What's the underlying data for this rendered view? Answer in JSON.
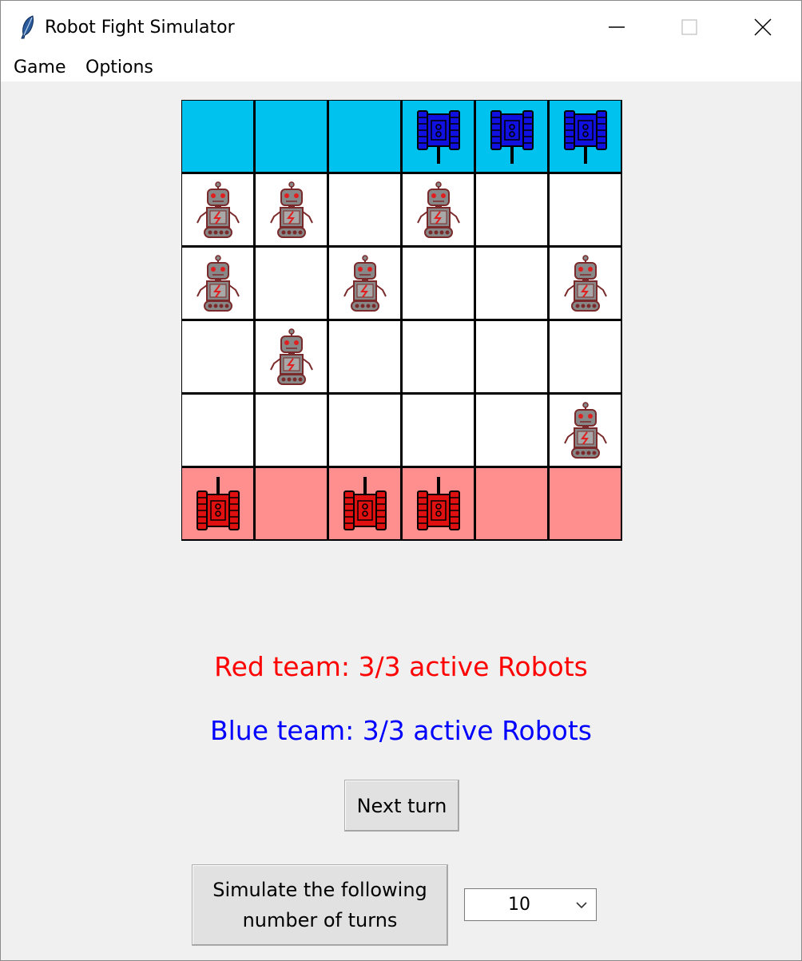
{
  "window": {
    "title": "Robot Fight Simulator"
  },
  "menu": {
    "items": [
      "Game",
      "Options"
    ]
  },
  "board": {
    "colors": {
      "blue_zone": "#00c2ee",
      "red_zone": "#ff8e8e",
      "empty": "#ffffff",
      "blue_tank": "#1010e0",
      "red_tank": "#e01010",
      "robot_body": "#888888",
      "robot_outline": "#7a2a2a"
    },
    "rows": [
      [
        {
          "zone": "blue",
          "piece": ""
        },
        {
          "zone": "blue",
          "piece": ""
        },
        {
          "zone": "blue",
          "piece": ""
        },
        {
          "zone": "blue",
          "piece": "blue-tank"
        },
        {
          "zone": "blue",
          "piece": "blue-tank"
        },
        {
          "zone": "blue",
          "piece": "blue-tank"
        }
      ],
      [
        {
          "zone": "empty",
          "piece": "robot"
        },
        {
          "zone": "empty",
          "piece": "robot"
        },
        {
          "zone": "empty",
          "piece": ""
        },
        {
          "zone": "empty",
          "piece": "robot"
        },
        {
          "zone": "empty",
          "piece": ""
        },
        {
          "zone": "empty",
          "piece": ""
        }
      ],
      [
        {
          "zone": "empty",
          "piece": "robot"
        },
        {
          "zone": "empty",
          "piece": ""
        },
        {
          "zone": "empty",
          "piece": "robot"
        },
        {
          "zone": "empty",
          "piece": ""
        },
        {
          "zone": "empty",
          "piece": ""
        },
        {
          "zone": "empty",
          "piece": "robot"
        }
      ],
      [
        {
          "zone": "empty",
          "piece": ""
        },
        {
          "zone": "empty",
          "piece": "robot"
        },
        {
          "zone": "empty",
          "piece": ""
        },
        {
          "zone": "empty",
          "piece": ""
        },
        {
          "zone": "empty",
          "piece": ""
        },
        {
          "zone": "empty",
          "piece": ""
        }
      ],
      [
        {
          "zone": "empty",
          "piece": ""
        },
        {
          "zone": "empty",
          "piece": ""
        },
        {
          "zone": "empty",
          "piece": ""
        },
        {
          "zone": "empty",
          "piece": ""
        },
        {
          "zone": "empty",
          "piece": ""
        },
        {
          "zone": "empty",
          "piece": "robot"
        }
      ],
      [
        {
          "zone": "red",
          "piece": "red-tank"
        },
        {
          "zone": "red",
          "piece": ""
        },
        {
          "zone": "red",
          "piece": "red-tank"
        },
        {
          "zone": "red",
          "piece": "red-tank"
        },
        {
          "zone": "red",
          "piece": ""
        },
        {
          "zone": "red",
          "piece": ""
        }
      ]
    ]
  },
  "status": {
    "red_team": "Red team: 3/3 active Robots",
    "blue_team": "Blue team: 3/3 active Robots",
    "red_color": "#ff0000",
    "blue_color": "#0000ff"
  },
  "controls": {
    "next_turn_label": "Next turn",
    "simulate_label_line1": "Simulate the following",
    "simulate_label_line2": "number of turns",
    "turns_selected": "10"
  },
  "icons": {
    "app": "feather-icon",
    "minimize": "minimize-icon",
    "maximize": "maximize-icon",
    "close": "close-icon",
    "dropdown": "chevron-down-icon"
  }
}
